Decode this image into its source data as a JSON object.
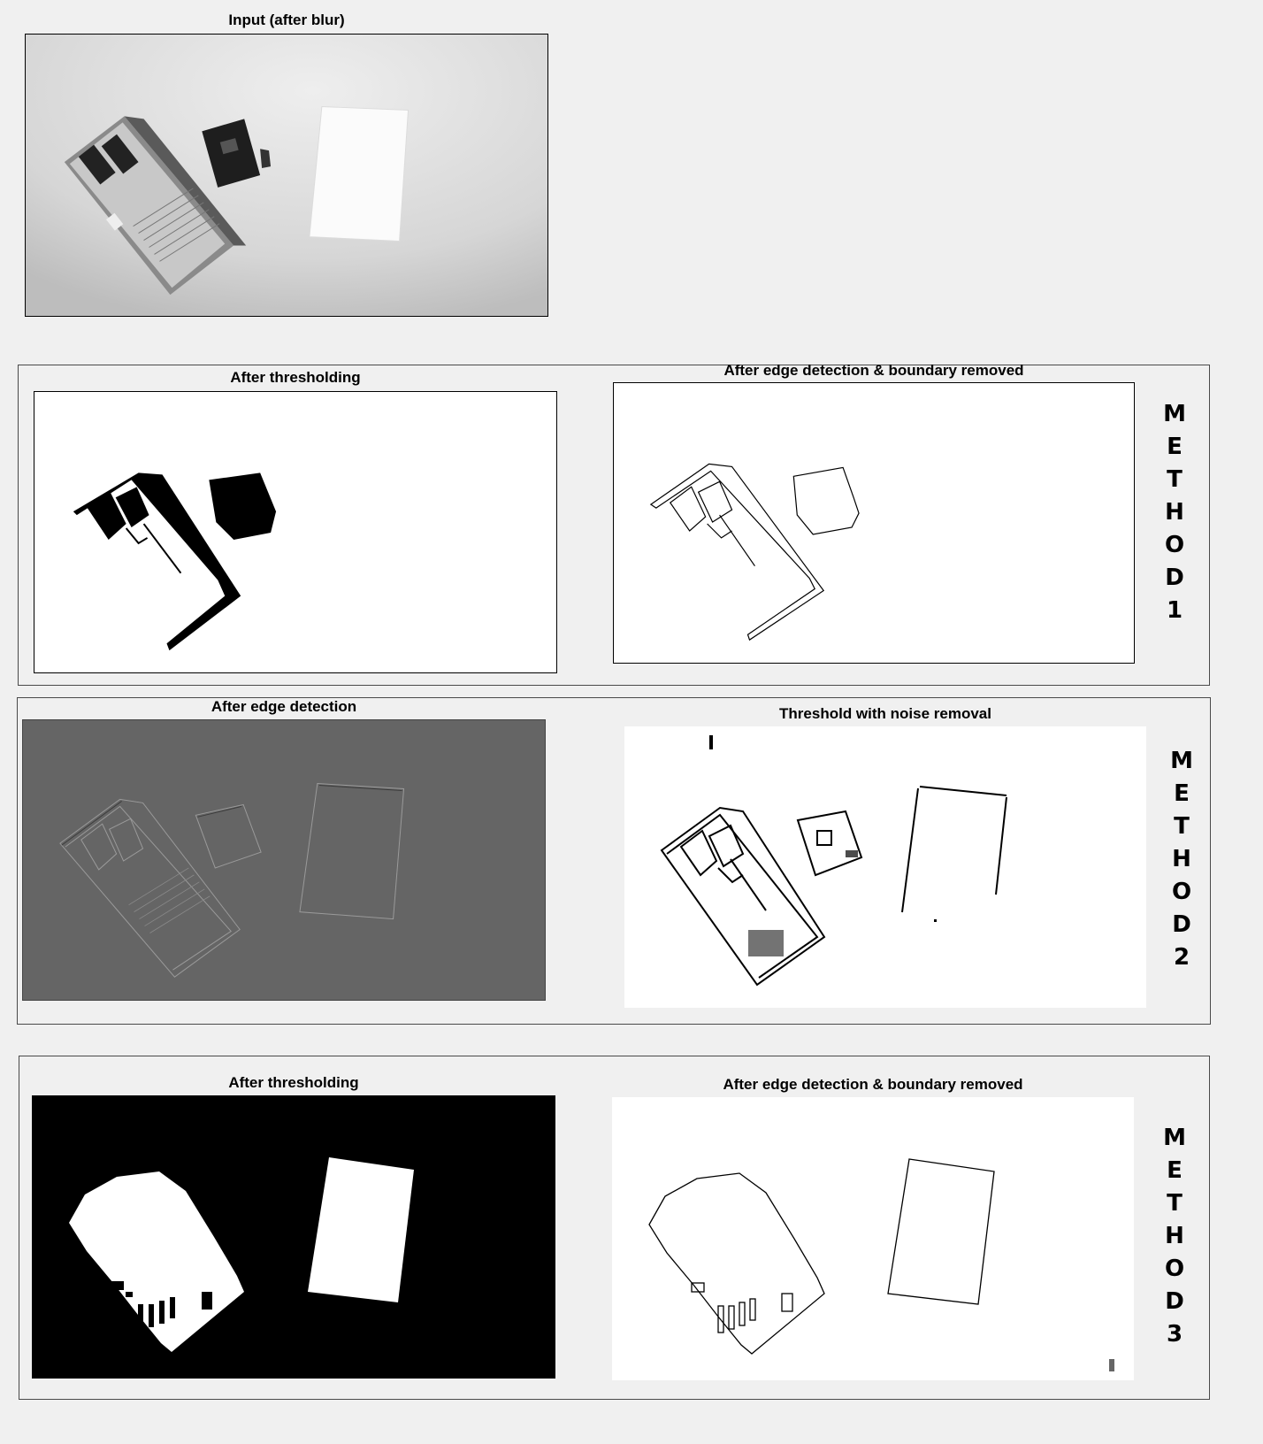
{
  "input": {
    "title": "Input (after blur)"
  },
  "method1": {
    "left_title": "After thresholding",
    "right_title": "After edge detection & boundary removed",
    "label": [
      "M",
      "E",
      "T",
      "H",
      "O",
      "D",
      "1"
    ]
  },
  "method2": {
    "left_title": "After edge detection",
    "right_title": "Threshold with noise removal",
    "label": [
      "M",
      "E",
      "T",
      "H",
      "O",
      "D",
      "2"
    ]
  },
  "method3": {
    "left_title": "After thresholding",
    "right_title": "After edge detection & boundary removed",
    "label": [
      "M",
      "E",
      "T",
      "H",
      "O",
      "D",
      "3"
    ]
  },
  "colors": {
    "page_bg": "#f0f0f0",
    "edge_gray": "#656565"
  }
}
